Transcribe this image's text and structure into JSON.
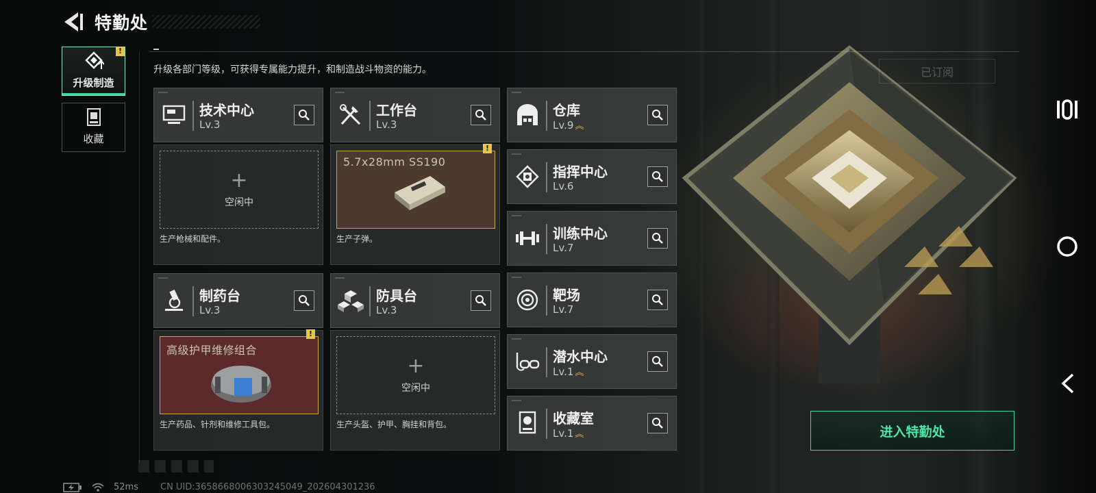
{
  "header": {
    "title": "特勤处"
  },
  "tabs": [
    {
      "label": "升级制造",
      "icon": "upgrade-craft-icon",
      "active": true,
      "alert": "!"
    },
    {
      "label": "收藏",
      "icon": "collection-icon",
      "active": false
    }
  ],
  "description": "升级各部门等级，可获得专属能力提升，和制造战斗物资的能力。",
  "subscribe_label": "已订阅",
  "facilities": [
    {
      "name": "技术中心",
      "level": "Lv.3",
      "icon": "computer-icon",
      "upgradable": false
    },
    {
      "name": "工作台",
      "level": "Lv.3",
      "icon": "tools-icon",
      "upgradable": false
    },
    {
      "name": "仓库",
      "level": "Lv.9",
      "icon": "warehouse-icon",
      "upgradable": true
    },
    {
      "name": "指挥中心",
      "level": "Lv.6",
      "icon": "chip-icon",
      "upgradable": false
    },
    {
      "name": "训练中心",
      "level": "Lv.7",
      "icon": "dumbbell-icon",
      "upgradable": false
    },
    {
      "name": "制药台",
      "level": "Lv.3",
      "icon": "microscope-icon",
      "upgradable": false
    },
    {
      "name": "防具台",
      "level": "Lv.3",
      "icon": "armor-blocks-icon",
      "upgradable": false
    },
    {
      "name": "靶场",
      "level": "Lv.7",
      "icon": "target-icon",
      "upgradable": false
    },
    {
      "name": "潜水中心",
      "level": "Lv.1",
      "icon": "diving-mask-icon",
      "upgradable": true
    },
    {
      "name": "收藏室",
      "level": "Lv.1",
      "icon": "display-case-icon",
      "upgradable": true
    }
  ],
  "production": {
    "tech": {
      "status": "空闲中",
      "desc": "生产枪械和配件。"
    },
    "workbench": {
      "item": "5.7x28mm SS190",
      "desc": "生产子弹。",
      "alert": "!"
    },
    "pharmacy": {
      "item": "高级护甲维修组合",
      "desc": "生产药品、针剂和维修工具包。",
      "alert": "!"
    },
    "armor": {
      "status": "空闲中",
      "desc": "生产头盔、护甲、胸挂和背包。"
    }
  },
  "enter_button": "进入特勤处",
  "status_bar": {
    "ping": "52ms",
    "uid": "CN UID:3658668006303245049_202604301236"
  },
  "colors": {
    "accent": "#3fd7a0",
    "upgrade_arrow": "#e0b24a",
    "alert": "#e3c64b"
  }
}
